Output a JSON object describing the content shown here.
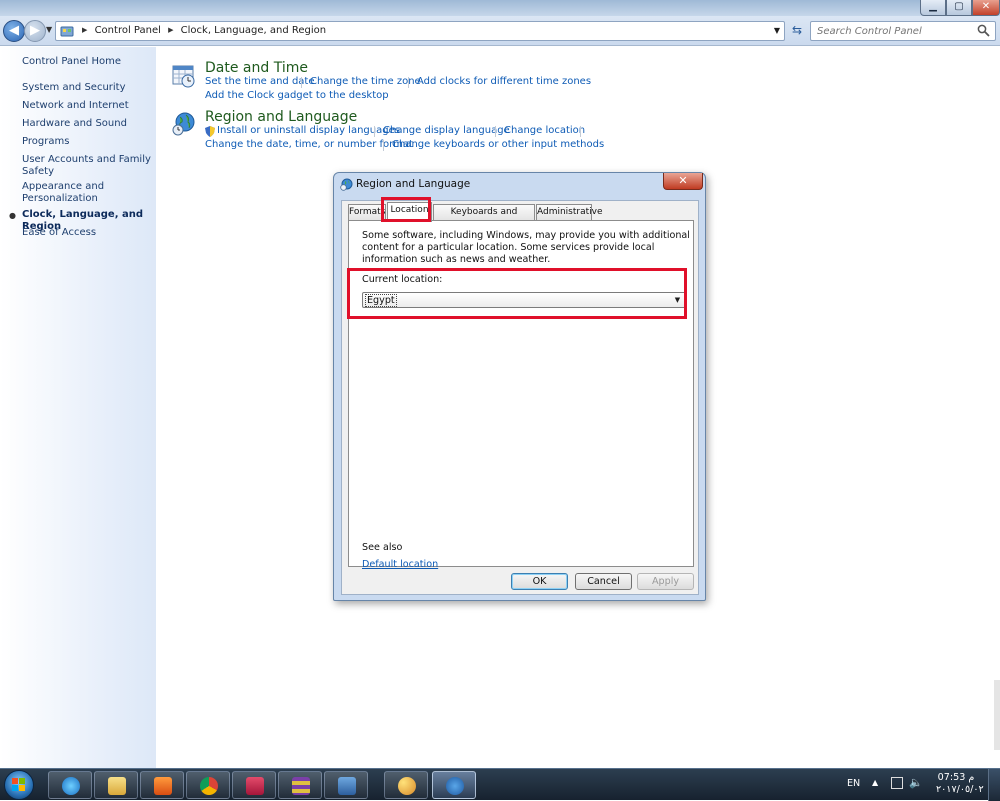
{
  "address_bar": {
    "crumbs": [
      "Control Panel",
      "Clock, Language, and Region"
    ],
    "search_placeholder": "Search Control Panel"
  },
  "left_pane": {
    "items": [
      {
        "label": "Control Panel Home"
      },
      {
        "label": "System and Security"
      },
      {
        "label": "Network and Internet"
      },
      {
        "label": "Hardware and Sound"
      },
      {
        "label": "Programs"
      },
      {
        "label": "User Accounts and Family Safety"
      },
      {
        "label": "Appearance and Personalization"
      },
      {
        "label": "Clock, Language, and Region"
      },
      {
        "label": "Ease of Access"
      }
    ]
  },
  "main": {
    "date_time": {
      "title": "Date and Time",
      "links": [
        "Set the time and date",
        "Change the time zone",
        "Add clocks for different time zones",
        "Add the Clock gadget to the desktop"
      ]
    },
    "region_language": {
      "title": "Region and Language",
      "links": [
        "Install or uninstall display languages",
        "Change display language",
        "Change location",
        "Change the date, time, or number format",
        "Change keyboards or other input methods"
      ]
    }
  },
  "dialog": {
    "title": "Region and Language",
    "close_label": "✕",
    "tabs": [
      "Formats",
      "Location",
      "Keyboards and Languages",
      "Administrative"
    ],
    "active_tab": "Location",
    "description": "Some software, including Windows, may provide you with additional content for a particular location. Some services provide local information such as news and weather.",
    "current_location_label": "Current location:",
    "current_location_value": "Egypt",
    "see_also": "See also",
    "default_location_link": "Default location",
    "buttons": {
      "ok": "OK",
      "cancel": "Cancel",
      "apply": "Apply"
    }
  },
  "taskbar": {
    "language": "EN",
    "time": "07:53 م",
    "date": "٢٠١٧/٠٥/٠٢"
  },
  "colors": {
    "link": "#0e5bb5",
    "category_title": "#1f5a1e",
    "highlight": "#e0102a"
  }
}
